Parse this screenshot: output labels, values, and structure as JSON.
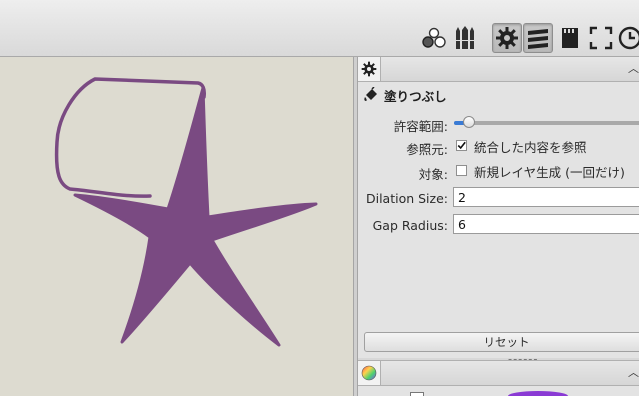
{
  "toolbar": {
    "buttons": [
      {
        "name": "brush-library-icon"
      },
      {
        "name": "brush-set-icon"
      },
      {
        "name": "gear-icon",
        "active": true
      },
      {
        "name": "layers-icon",
        "active": true
      },
      {
        "name": "memory-card-icon"
      },
      {
        "name": "fullscreen-icon"
      },
      {
        "name": "clock-icon"
      }
    ]
  },
  "colors": {
    "canvas_bg": "#dddbd0",
    "stroke": "#7a4a82",
    "accent": "#3a7bd5"
  },
  "tool_panel": {
    "tab_icon": "gear-icon",
    "title": "塗りつぶし",
    "title_icon": "paint-bucket-icon",
    "tolerance": {
      "label": "許容範囲:",
      "value_fraction": 0.08
    },
    "reference": {
      "label": "参照元:",
      "checkbox_label": "統合した内容を参照",
      "checked": true
    },
    "target": {
      "label": "対象:",
      "checkbox_label": "新規レイヤ生成 (一回だけ)",
      "checked": false
    },
    "dilation": {
      "label": "Dilation Size:",
      "value": "2"
    },
    "gap": {
      "label": "Gap Radius:",
      "value": "6"
    },
    "reset_label": "リセット"
  },
  "color_panel": {
    "tab_icon": "color-wheel-icon"
  }
}
